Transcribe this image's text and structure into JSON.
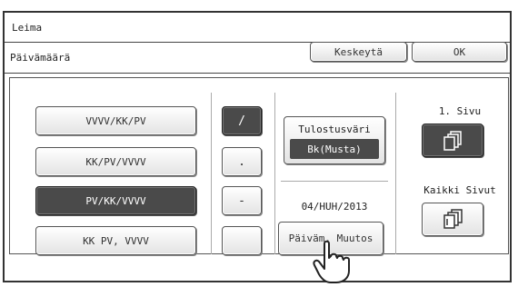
{
  "window": {
    "title": "Leima"
  },
  "subheader": {
    "label": "Päivämäärä",
    "cancel_label": "Keskeytä",
    "ok_label": "OK"
  },
  "date_formats": {
    "items": [
      {
        "label": "VVVV/KK/PV",
        "selected": false
      },
      {
        "label": "KK/PV/VVVV",
        "selected": false
      },
      {
        "label": "PV/KK/VVVV",
        "selected": true
      },
      {
        "label": "KK PV, VVVV",
        "selected": false
      }
    ]
  },
  "separators": {
    "items": [
      {
        "label": "/",
        "selected": true
      },
      {
        "label": ".",
        "selected": false
      },
      {
        "label": "-",
        "selected": false
      },
      {
        "label": "",
        "selected": false
      }
    ]
  },
  "print_color": {
    "label": "Tulostusväri",
    "value": "Bk(Musta)"
  },
  "date": {
    "current": "04/HUH/2013",
    "change_label": "Päiväm. Muutos"
  },
  "pages": {
    "first_label": "1. Sivu",
    "all_label": "Kaikki Sivut",
    "first_selected": true,
    "all_selected": false
  },
  "colors": {
    "selected": "#4a4a4a",
    "button_bg": "#e3e3e3",
    "border": "#333333"
  }
}
